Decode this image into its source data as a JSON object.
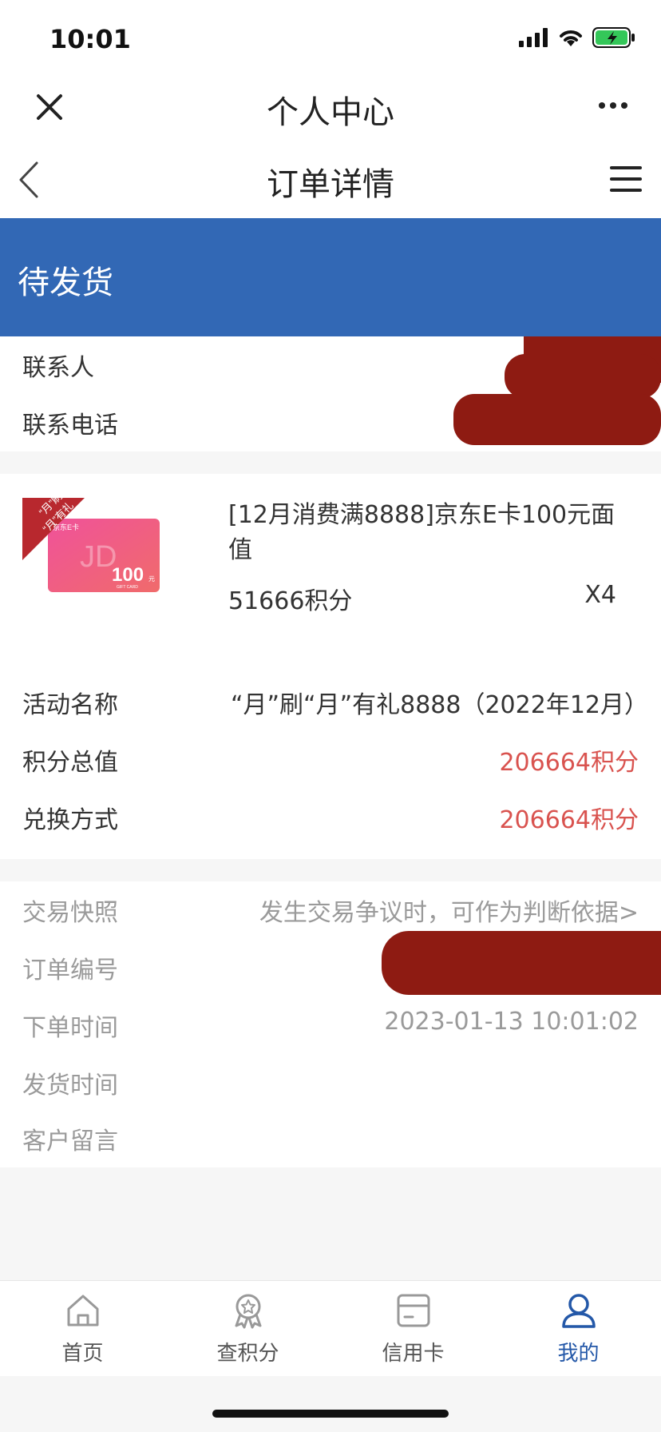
{
  "status_bar": {
    "time": "10:01"
  },
  "wechat_bar": {
    "title": "个人中心"
  },
  "header": {
    "title": "订单详情"
  },
  "order_status": "待发货",
  "contact": {
    "name_label": "联系人",
    "phone_label": "联系电话"
  },
  "product": {
    "title": "[12月消费满8888]京东E卡100元面值",
    "points": "51666积分",
    "quantity": "X4",
    "image": {
      "ribbon_line1": "“月”刷",
      "ribbon_line2": "“月”有礼",
      "card_brand": "京东E卡",
      "card_logo": "JD",
      "card_value": "100",
      "card_unit": "元",
      "card_sub": "GIFT CARD"
    }
  },
  "activity": {
    "name_label": "活动名称",
    "name_value": "“月”刷“月”有礼8888（2022年12月）",
    "total_label": "积分总值",
    "total_value": "206664积分",
    "method_label": "兑换方式",
    "method_value": "206664积分"
  },
  "order_info": {
    "snapshot_label": "交易快照",
    "snapshot_value": "发生交易争议时，可作为判断依据>",
    "order_no_label": "订单编号",
    "order_time_label": "下单时间",
    "order_time_value": "2023-01-13 10:01:02",
    "ship_time_label": "发货时间",
    "remark_label": "客户留言"
  },
  "tabbar": {
    "items": [
      {
        "label": "首页",
        "icon": "home-icon"
      },
      {
        "label": "查积分",
        "icon": "award-icon"
      },
      {
        "label": "信用卡",
        "icon": "card-icon"
      },
      {
        "label": "我的",
        "icon": "user-icon"
      }
    ]
  },
  "colors": {
    "banner_blue": "#3268b5",
    "accent_red": "#d9534f",
    "tab_active": "#2458a8"
  }
}
